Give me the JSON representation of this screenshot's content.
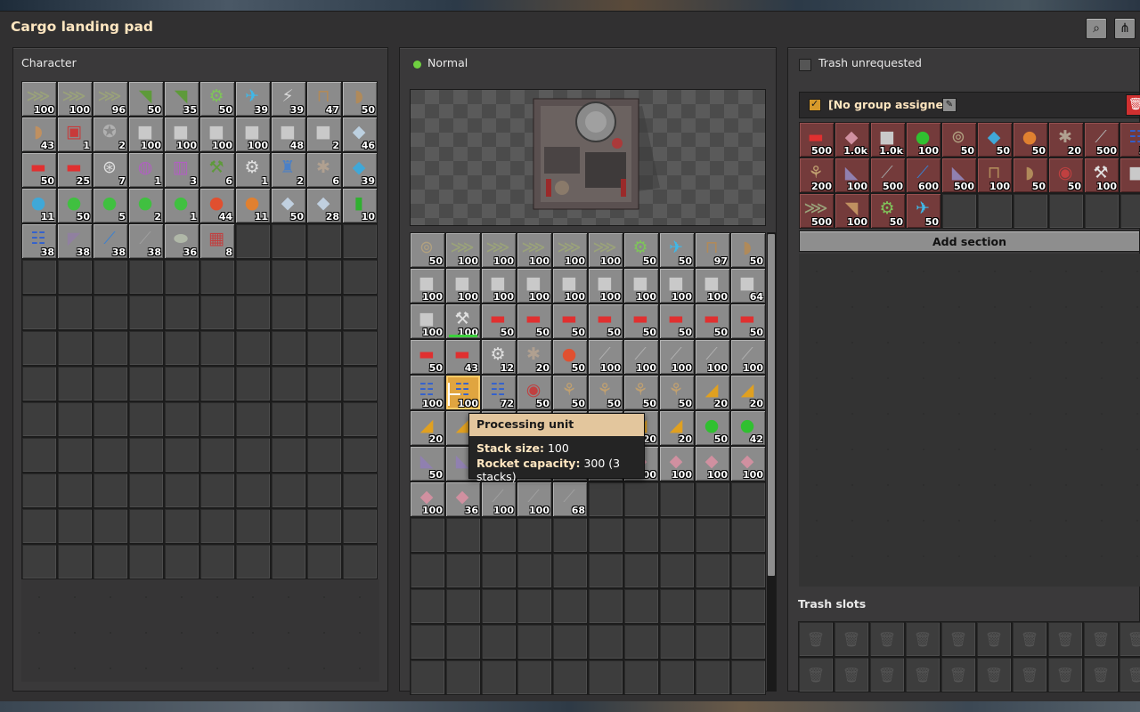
{
  "window": {
    "title": "Cargo landing pad"
  },
  "character": {
    "label": "Character",
    "items": [
      {
        "icon": "⋙",
        "color": "#9aa27a",
        "count": "100"
      },
      {
        "icon": "⋙",
        "color": "#9aa27a",
        "count": "100"
      },
      {
        "icon": "⋙",
        "color": "#9aa27a",
        "count": "96"
      },
      {
        "icon": "◥",
        "color": "#5e9a3a",
        "count": "50"
      },
      {
        "icon": "◥",
        "color": "#5e9a3a",
        "count": "35"
      },
      {
        "icon": "⚙",
        "color": "#7fc45a",
        "count": "50"
      },
      {
        "icon": "✈",
        "color": "#3fb8e8",
        "count": "39"
      },
      {
        "icon": "⚡",
        "color": "#d9d9d9",
        "count": "39"
      },
      {
        "icon": "⊓",
        "color": "#b08a5a",
        "count": "47"
      },
      {
        "icon": "◗",
        "color": "#b08a5a",
        "count": "50"
      },
      {
        "icon": "◗",
        "color": "#c09060",
        "count": "43"
      },
      {
        "icon": "▣",
        "color": "#c83a3a",
        "count": "1"
      },
      {
        "icon": "✪",
        "color": "#b0b0b0",
        "count": "2"
      },
      {
        "icon": "■",
        "color": "#c9c9c9",
        "count": "100"
      },
      {
        "icon": "■",
        "color": "#c9c9c9",
        "count": "100"
      },
      {
        "icon": "■",
        "color": "#c9c9c9",
        "count": "100"
      },
      {
        "icon": "■",
        "color": "#c9c9c9",
        "count": "100"
      },
      {
        "icon": "■",
        "color": "#c9c9c9",
        "count": "48"
      },
      {
        "icon": "■",
        "color": "#c9c9c9",
        "count": "2"
      },
      {
        "icon": "◆",
        "color": "#bcd0e0",
        "count": "46"
      },
      {
        "icon": "▬",
        "color": "#e03030",
        "count": "50"
      },
      {
        "icon": "▬",
        "color": "#e03030",
        "count": "25"
      },
      {
        "icon": "⊛",
        "color": "#dddddd",
        "count": "7"
      },
      {
        "icon": "◍",
        "color": "#b060c0",
        "count": "1"
      },
      {
        "icon": "▥",
        "color": "#b060c0",
        "count": "3"
      },
      {
        "icon": "⚒",
        "color": "#5e9a3a",
        "count": "6"
      },
      {
        "icon": "⚙",
        "color": "#e0e0e0",
        "count": "1"
      },
      {
        "icon": "♜",
        "color": "#4a80c8",
        "count": "2"
      },
      {
        "icon": "✱",
        "color": "#b0a090",
        "count": "6"
      },
      {
        "icon": "◆",
        "color": "#40a8d8",
        "count": "39"
      },
      {
        "icon": "●",
        "color": "#40a8d8",
        "count": "11"
      },
      {
        "icon": "●",
        "color": "#40c040",
        "count": "50"
      },
      {
        "icon": "●",
        "color": "#40c040",
        "count": "5"
      },
      {
        "icon": "●",
        "color": "#40c040",
        "count": "2"
      },
      {
        "icon": "●",
        "color": "#40c040",
        "count": "1"
      },
      {
        "icon": "●",
        "color": "#e05030",
        "count": "44"
      },
      {
        "icon": "●",
        "color": "#e08030",
        "count": "11"
      },
      {
        "icon": "◆",
        "color": "#c0d0e0",
        "count": "50"
      },
      {
        "icon": "◆",
        "color": "#c0d0e0",
        "count": "28"
      },
      {
        "icon": "▮",
        "color": "#30b030",
        "count": "10"
      },
      {
        "icon": "☷",
        "color": "#3060d0",
        "count": "38"
      },
      {
        "icon": "◤",
        "color": "#9080a0",
        "count": "38"
      },
      {
        "icon": "⟋",
        "color": "#3a80d0",
        "count": "38"
      },
      {
        "icon": "⟋",
        "color": "#a0a0a0",
        "count": "38"
      },
      {
        "icon": "⬬",
        "color": "#b0b8a8",
        "count": "36"
      },
      {
        "icon": "▦",
        "color": "#c04040",
        "count": "8"
      }
    ]
  },
  "landing_pad": {
    "status_label": "Normal",
    "status_color": "#6fd040",
    "items": [
      {
        "icon": "⊚",
        "color": "#b0a080",
        "count": "50"
      },
      {
        "icon": "⋙",
        "color": "#9aa27a",
        "count": "100"
      },
      {
        "icon": "⋙",
        "color": "#9aa27a",
        "count": "100"
      },
      {
        "icon": "⋙",
        "color": "#9aa27a",
        "count": "100"
      },
      {
        "icon": "⋙",
        "color": "#9aa27a",
        "count": "100"
      },
      {
        "icon": "⋙",
        "color": "#9aa27a",
        "count": "100"
      },
      {
        "icon": "⚙",
        "color": "#7fc45a",
        "count": "50"
      },
      {
        "icon": "✈",
        "color": "#3fb8e8",
        "count": "50"
      },
      {
        "icon": "⊓",
        "color": "#b08a5a",
        "count": "97"
      },
      {
        "icon": "◗",
        "color": "#b08a5a",
        "count": "50"
      },
      {
        "icon": "■",
        "color": "#c9c9c9",
        "count": "100"
      },
      {
        "icon": "■",
        "color": "#c9c9c9",
        "count": "100"
      },
      {
        "icon": "■",
        "color": "#c9c9c9",
        "count": "100"
      },
      {
        "icon": "■",
        "color": "#c9c9c9",
        "count": "100"
      },
      {
        "icon": "■",
        "color": "#c9c9c9",
        "count": "100"
      },
      {
        "icon": "■",
        "color": "#c9c9c9",
        "count": "100"
      },
      {
        "icon": "■",
        "color": "#c9c9c9",
        "count": "100"
      },
      {
        "icon": "■",
        "color": "#c9c9c9",
        "count": "100"
      },
      {
        "icon": "■",
        "color": "#c9c9c9",
        "count": "100"
      },
      {
        "icon": "■",
        "color": "#c9c9c9",
        "count": "64"
      },
      {
        "icon": "■",
        "color": "#c9c9c9",
        "count": "100"
      },
      {
        "icon": "⚒",
        "color": "#e0e0e0",
        "count": "100",
        "bar": true
      },
      {
        "icon": "▬",
        "color": "#e03030",
        "count": "50"
      },
      {
        "icon": "▬",
        "color": "#e03030",
        "count": "50"
      },
      {
        "icon": "▬",
        "color": "#e03030",
        "count": "50"
      },
      {
        "icon": "▬",
        "color": "#e03030",
        "count": "50"
      },
      {
        "icon": "▬",
        "color": "#e03030",
        "count": "50"
      },
      {
        "icon": "▬",
        "color": "#e03030",
        "count": "50"
      },
      {
        "icon": "▬",
        "color": "#e03030",
        "count": "50"
      },
      {
        "icon": "▬",
        "color": "#e03030",
        "count": "50"
      },
      {
        "icon": "▬",
        "color": "#e03030",
        "count": "50"
      },
      {
        "icon": "▬",
        "color": "#e03030",
        "count": "43"
      },
      {
        "icon": "⚙",
        "color": "#e0e0e0",
        "count": "12"
      },
      {
        "icon": "✱",
        "color": "#b0a090",
        "count": "20"
      },
      {
        "icon": "●",
        "color": "#e05030",
        "count": "50"
      },
      {
        "icon": "⟋",
        "color": "#b0b0b0",
        "count": "100"
      },
      {
        "icon": "⟋",
        "color": "#b0b0b0",
        "count": "100"
      },
      {
        "icon": "⟋",
        "color": "#b0b0b0",
        "count": "100"
      },
      {
        "icon": "⟋",
        "color": "#b0b0b0",
        "count": "100"
      },
      {
        "icon": "⟋",
        "color": "#b0b0b0",
        "count": "100"
      },
      {
        "icon": "☷",
        "color": "#3060d0",
        "count": "100"
      },
      {
        "icon": "☷",
        "color": "#3060d0",
        "count": "100",
        "highlight": true
      },
      {
        "icon": "☷",
        "color": "#3060d0",
        "count": "72"
      },
      {
        "icon": "◉",
        "color": "#c04040",
        "count": "50"
      },
      {
        "icon": "⚘",
        "color": "#c0a070",
        "count": "50"
      },
      {
        "icon": "⚘",
        "color": "#c0a070",
        "count": "50"
      },
      {
        "icon": "⚘",
        "color": "#c0a070",
        "count": "50"
      },
      {
        "icon": "⚘",
        "color": "#c0a070",
        "count": "50"
      },
      {
        "icon": "◢",
        "color": "#e0a020",
        "count": "20"
      },
      {
        "icon": "◢",
        "color": "#e0a020",
        "count": "20"
      },
      {
        "icon": "◢",
        "color": "#e0a020",
        "count": "20"
      },
      {
        "icon": "◢",
        "color": "#e0a020",
        "count": "2"
      },
      {
        "icon": "◢",
        "color": "#e0a020",
        "count": ""
      },
      {
        "icon": "◢",
        "color": "#e0a020",
        "count": ""
      },
      {
        "icon": "◢",
        "color": "#e0a020",
        "count": ""
      },
      {
        "icon": "◢",
        "color": "#e0a020",
        "count": "20"
      },
      {
        "icon": "◢",
        "color": "#e0a020",
        "count": "20"
      },
      {
        "icon": "◢",
        "color": "#e0a020",
        "count": "20"
      },
      {
        "icon": "●",
        "color": "#30c030",
        "count": "50"
      },
      {
        "icon": "●",
        "color": "#30c030",
        "count": "42"
      },
      {
        "icon": "◣",
        "color": "#9080b0",
        "count": "50"
      },
      {
        "icon": "◣",
        "color": "#9080b0",
        "count": "5"
      },
      {
        "icon": "◣",
        "color": "#9080b0",
        "count": ""
      },
      {
        "icon": "◣",
        "color": "#9080b0",
        "count": ""
      },
      {
        "icon": "◣",
        "color": "#9080b0",
        "count": ""
      },
      {
        "icon": "◣",
        "color": "#9080b0",
        "count": ""
      },
      {
        "icon": "◆",
        "color": "#d090a0",
        "count": "100"
      },
      {
        "icon": "◆",
        "color": "#d090a0",
        "count": "100"
      },
      {
        "icon": "◆",
        "color": "#d090a0",
        "count": "100"
      },
      {
        "icon": "◆",
        "color": "#d090a0",
        "count": "100"
      },
      {
        "icon": "◆",
        "color": "#d090a0",
        "count": "100"
      },
      {
        "icon": "◆",
        "color": "#d090a0",
        "count": "36"
      },
      {
        "icon": "⟋",
        "color": "#a0a0a0",
        "count": "100"
      },
      {
        "icon": "⟋",
        "color": "#a0a0a0",
        "count": "100"
      },
      {
        "icon": "⟋",
        "color": "#a0a0a0",
        "count": "68"
      }
    ]
  },
  "tooltip": {
    "title": "Processing unit",
    "stack_label": "Stack size:",
    "stack_value": "100",
    "rocket_label": "Rocket capacity:",
    "rocket_value": "300 (3 stacks)"
  },
  "logistics": {
    "trash_unrequested_label": "Trash unrequested",
    "group_label": "[No group assigned]",
    "add_section_label": "Add section",
    "trash_slots_label": "Trash slots",
    "requests": [
      {
        "icon": "▬",
        "color": "#e03030",
        "count": "500"
      },
      {
        "icon": "◆",
        "color": "#d090a0",
        "count": "1.0k"
      },
      {
        "icon": "■",
        "color": "#c9c9c9",
        "count": "1.0k"
      },
      {
        "icon": "●",
        "color": "#30c030",
        "count": "100"
      },
      {
        "icon": "⊚",
        "color": "#b0a080",
        "count": "50"
      },
      {
        "icon": "◆",
        "color": "#40a8d8",
        "count": "50"
      },
      {
        "icon": "●",
        "color": "#e08030",
        "count": "50"
      },
      {
        "icon": "✱",
        "color": "#b0a090",
        "count": "20"
      },
      {
        "icon": "⟋",
        "color": "#b0b0b0",
        "count": "500"
      },
      {
        "icon": "☷",
        "color": "#3060d0",
        "count": "50"
      },
      {
        "icon": "⚘",
        "color": "#c0a070",
        "count": "200"
      },
      {
        "icon": "◣",
        "color": "#9080b0",
        "count": "100"
      },
      {
        "icon": "⟋",
        "color": "#a0a0a0",
        "count": "500"
      },
      {
        "icon": "⟋",
        "color": "#3a80d0",
        "count": "600"
      },
      {
        "icon": "◣",
        "color": "#9080b0",
        "count": "500"
      },
      {
        "icon": "⊓",
        "color": "#b08a5a",
        "count": "100"
      },
      {
        "icon": "◗",
        "color": "#b08a5a",
        "count": "50"
      },
      {
        "icon": "◉",
        "color": "#c04040",
        "count": "50"
      },
      {
        "icon": "⚒",
        "color": "#e0e0e0",
        "count": "100"
      },
      {
        "icon": "■",
        "color": "#c9c9c9",
        "count": ""
      },
      {
        "icon": "⋙",
        "color": "#9aa27a",
        "count": "500"
      },
      {
        "icon": "◥",
        "color": "#c09060",
        "count": "100"
      },
      {
        "icon": "⚙",
        "color": "#7fc45a",
        "count": "50"
      },
      {
        "icon": "✈",
        "color": "#3fb8e8",
        "count": "50"
      }
    ]
  }
}
